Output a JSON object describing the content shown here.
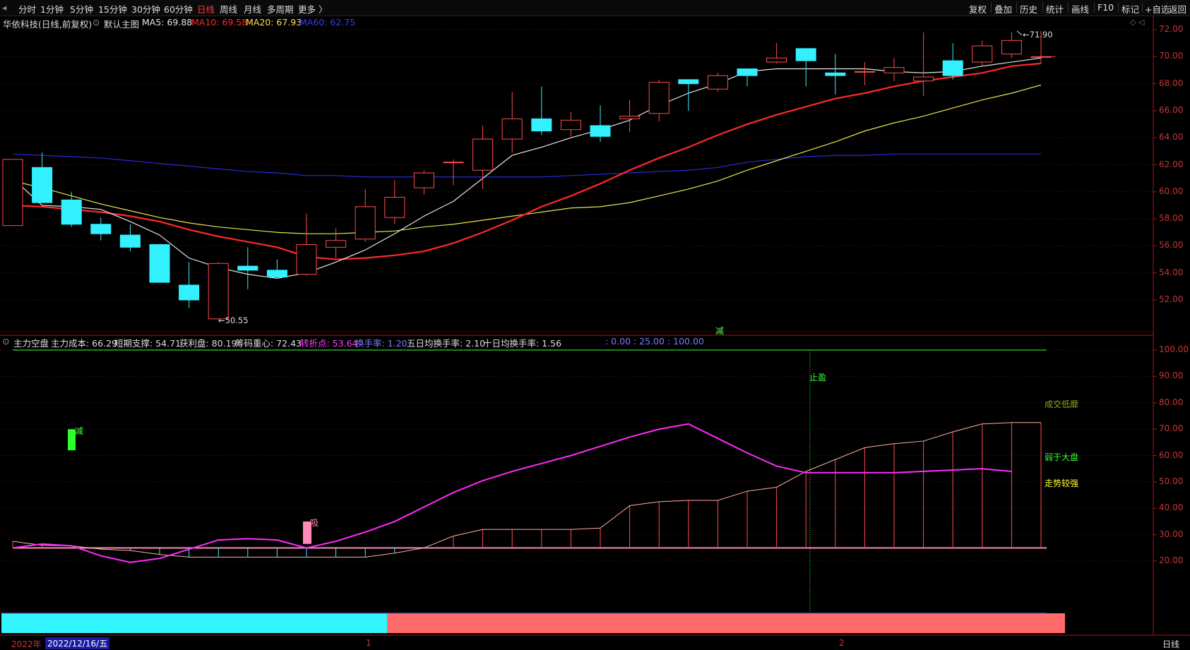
{
  "toolbar": {
    "left_icon": "chevron-left-icon",
    "periods": [
      "分时",
      "1分钟",
      "5分钟",
      "15分钟",
      "30分钟",
      "60分钟",
      "日线",
      "周线",
      "月线",
      "多周期",
      "更多 〉"
    ],
    "active_period": "日线",
    "right_buttons": [
      "复权",
      "叠加",
      "历史",
      "统计",
      "画线",
      "F10",
      "标记",
      "+自选",
      "返回"
    ]
  },
  "main_chart": {
    "stock_name": "华依科技(日线,前复权)",
    "chart_name": "默认主图",
    "ma5_label": "MA5: 69.88",
    "ma10_label": "MA10: 69.58",
    "ma20_label": "MA20: 67.93",
    "ma60_label": "MA60: 62.75",
    "high_marker": "71.90",
    "low_marker": "50.55",
    "signal_mark": "减",
    "y_ticks": [
      "72.00",
      "70.00",
      "68.00",
      "66.00",
      "64.00",
      "62.00",
      "60.00",
      "58.00",
      "56.00",
      "54.00",
      "52.00"
    ]
  },
  "sub_chart": {
    "indicator_name": "主力空盘",
    "cost_label": "主力成本: 66.29",
    "support_label": "短期支撑: 54.71",
    "profit_label": "获利盘: 80.19",
    "chip_label": "筹码重心: 72.43",
    "turn_label": "转折点: 53.64",
    "turnover_label": "换手率: 1.20",
    "turnover5_label": "五日均换手率: 2.10",
    "turnover10_label": "十日均换手率: 1.56",
    "levels_label": ": 0.00 : 25.00 : 100.00",
    "stop_profit": "止盈",
    "signal_reduce": "减",
    "signal_absorb": "吸",
    "note_low_volume": "成交低靡",
    "note_weaker": "弱于大盘",
    "note_strong": "走势较强",
    "y_ticks": [
      "100.00",
      "90.00",
      "80.00",
      "70.00",
      "60.00",
      "50.00",
      "40.00",
      "30.00",
      "20.00"
    ]
  },
  "bottom_bar": {
    "year": "2022年",
    "date": "2022/12/16/五",
    "month1": "1",
    "month2": "2",
    "period_label": "日线"
  },
  "candles": [
    {
      "o": 57.5,
      "h": 62.4,
      "l": 57.5,
      "c": 62.4
    },
    {
      "o": 61.8,
      "h": 62.9,
      "l": 59.2,
      "c": 59.2
    },
    {
      "o": 59.4,
      "h": 60.0,
      "l": 57.4,
      "c": 57.6
    },
    {
      "o": 57.6,
      "h": 58.1,
      "l": 56.4,
      "c": 56.9
    },
    {
      "o": 56.8,
      "h": 57.6,
      "l": 55.6,
      "c": 55.9
    },
    {
      "o": 56.1,
      "h": 56.1,
      "l": 53.3,
      "c": 53.3
    },
    {
      "o": 53.1,
      "h": 54.8,
      "l": 51.4,
      "c": 52.0
    },
    {
      "o": 50.6,
      "h": 54.8,
      "l": 50.55,
      "c": 54.7
    },
    {
      "o": 54.5,
      "h": 55.9,
      "l": 52.8,
      "c": 54.2
    },
    {
      "o": 54.2,
      "h": 55.0,
      "l": 53.6,
      "c": 53.7
    },
    {
      "o": 53.9,
      "h": 58.4,
      "l": 53.8,
      "c": 56.1
    },
    {
      "o": 55.9,
      "h": 57.3,
      "l": 55.1,
      "c": 56.4
    },
    {
      "o": 56.5,
      "h": 60.2,
      "l": 56.3,
      "c": 58.9
    },
    {
      "o": 58.1,
      "h": 60.9,
      "l": 57.6,
      "c": 59.6
    },
    {
      "o": 60.3,
      "h": 61.6,
      "l": 59.8,
      "c": 61.4
    },
    {
      "o": 62.2,
      "h": 62.4,
      "l": 60.5,
      "c": 62.2
    },
    {
      "o": 61.6,
      "h": 64.9,
      "l": 60.2,
      "c": 63.9
    },
    {
      "o": 63.9,
      "h": 67.4,
      "l": 62.9,
      "c": 65.4
    },
    {
      "o": 65.4,
      "h": 67.8,
      "l": 64.2,
      "c": 64.5
    },
    {
      "o": 64.6,
      "h": 65.9,
      "l": 64.1,
      "c": 65.3
    },
    {
      "o": 64.9,
      "h": 66.4,
      "l": 63.7,
      "c": 64.1
    },
    {
      "o": 65.4,
      "h": 66.8,
      "l": 64.4,
      "c": 65.6
    },
    {
      "o": 65.8,
      "h": 68.3,
      "l": 65.2,
      "c": 68.1
    },
    {
      "o": 68.3,
      "h": 68.3,
      "l": 66.0,
      "c": 68.0
    },
    {
      "o": 67.6,
      "h": 68.8,
      "l": 67.4,
      "c": 68.6
    },
    {
      "o": 69.1,
      "h": 69.1,
      "l": 67.8,
      "c": 68.6
    },
    {
      "o": 69.6,
      "h": 71.0,
      "l": 69.5,
      "c": 69.9
    },
    {
      "o": 70.6,
      "h": 70.6,
      "l": 67.8,
      "c": 69.7
    },
    {
      "o": 68.8,
      "h": 70.2,
      "l": 67.2,
      "c": 68.6
    },
    {
      "o": 68.9,
      "h": 69.6,
      "l": 67.9,
      "c": 68.9
    },
    {
      "o": 68.8,
      "h": 69.9,
      "l": 68.2,
      "c": 69.2
    },
    {
      "o": 68.2,
      "h": 71.8,
      "l": 67.1,
      "c": 68.5
    },
    {
      "o": 69.7,
      "h": 71.0,
      "l": 68.3,
      "c": 68.6
    },
    {
      "o": 69.6,
      "h": 71.2,
      "l": 69.3,
      "c": 70.8
    },
    {
      "o": 70.2,
      "h": 71.8,
      "l": 69.9,
      "c": 71.2
    },
    {
      "o": 70.0,
      "h": 71.9,
      "l": 69.5,
      "c": 70.0
    }
  ],
  "ma5": [
    61.0,
    59.0,
    58.9,
    58.7,
    57.8,
    56.8,
    55.1,
    54.4,
    53.9,
    53.6,
    54.0,
    54.8,
    55.7,
    56.9,
    58.2,
    59.3,
    61.0,
    62.7,
    63.3,
    64.0,
    64.6,
    65.3,
    66.4,
    67.3,
    68.0,
    68.9,
    69.1,
    69.1,
    69.1,
    69.1,
    68.9,
    68.8,
    68.9,
    69.3,
    69.6,
    69.9
  ],
  "ma10": [
    59.0,
    58.9,
    58.7,
    58.5,
    58.2,
    57.8,
    57.2,
    56.7,
    56.3,
    55.9,
    55.2,
    55.0,
    55.1,
    55.3,
    55.6,
    56.2,
    57.0,
    57.9,
    58.9,
    59.7,
    60.6,
    61.6,
    62.5,
    63.3,
    64.2,
    65.0,
    65.7,
    66.3,
    66.9,
    67.3,
    67.8,
    68.2,
    68.5,
    68.8,
    69.3,
    69.5
  ],
  "ma20": [
    60.8,
    60.3,
    59.7,
    59.1,
    58.6,
    58.1,
    57.7,
    57.4,
    57.2,
    57.0,
    56.9,
    56.9,
    57.0,
    57.1,
    57.4,
    57.6,
    57.9,
    58.2,
    58.5,
    58.8,
    58.9,
    59.2,
    59.7,
    60.2,
    60.8,
    61.6,
    62.3,
    63.0,
    63.7,
    64.5,
    65.1,
    65.6,
    66.2,
    66.8,
    67.3,
    67.9
  ],
  "ma60": [
    62.8,
    62.7,
    62.6,
    62.5,
    62.3,
    62.1,
    61.9,
    61.7,
    61.5,
    61.4,
    61.2,
    61.2,
    61.1,
    61.1,
    61.1,
    61.1,
    61.1,
    61.1,
    61.1,
    61.2,
    61.3,
    61.4,
    61.5,
    61.6,
    61.8,
    62.2,
    62.4,
    62.6,
    62.7,
    62.7,
    62.8,
    62.8,
    62.8,
    62.8,
    62.8,
    62.8
  ],
  "turn_line": [
    25.0,
    26.5,
    25.8,
    22.0,
    19.5,
    21.0,
    24.5,
    28.0,
    28.5,
    28.0,
    25.0,
    27.5,
    31.0,
    35.0,
    40.5,
    46.0,
    50.5,
    54.0,
    57.0,
    60.0,
    63.5,
    67.0,
    70.0,
    72.0,
    66.5,
    61.0,
    56.0,
    53.5,
    53.5,
    53.5,
    53.5,
    54.0,
    54.5,
    55.0,
    54.0
  ],
  "chip_line": [
    27.5,
    26.0,
    25.8,
    24.5,
    24.0,
    22.5,
    21.5,
    21.5,
    21.5,
    21.5,
    21.5,
    21.5,
    21.5,
    23.0,
    25.0,
    29.5,
    32.0,
    32.0,
    32.0,
    32.0,
    32.5,
    41.0,
    42.5,
    43.0,
    43.0,
    46.5,
    48.0,
    54.0,
    58.5,
    63.0,
    64.5,
    65.5,
    69.0,
    72.0,
    72.5,
    72.5
  ],
  "colors": {
    "ma5": "#e6e6e6",
    "ma10": "#ff2a2a",
    "ma20": "#e8e84a",
    "ma60": "#2a2ad8",
    "candle_up": "#ff4d4d",
    "candle_down": "#33f0ff",
    "turn_line": "#ff2bff",
    "axis": "#a01818"
  }
}
